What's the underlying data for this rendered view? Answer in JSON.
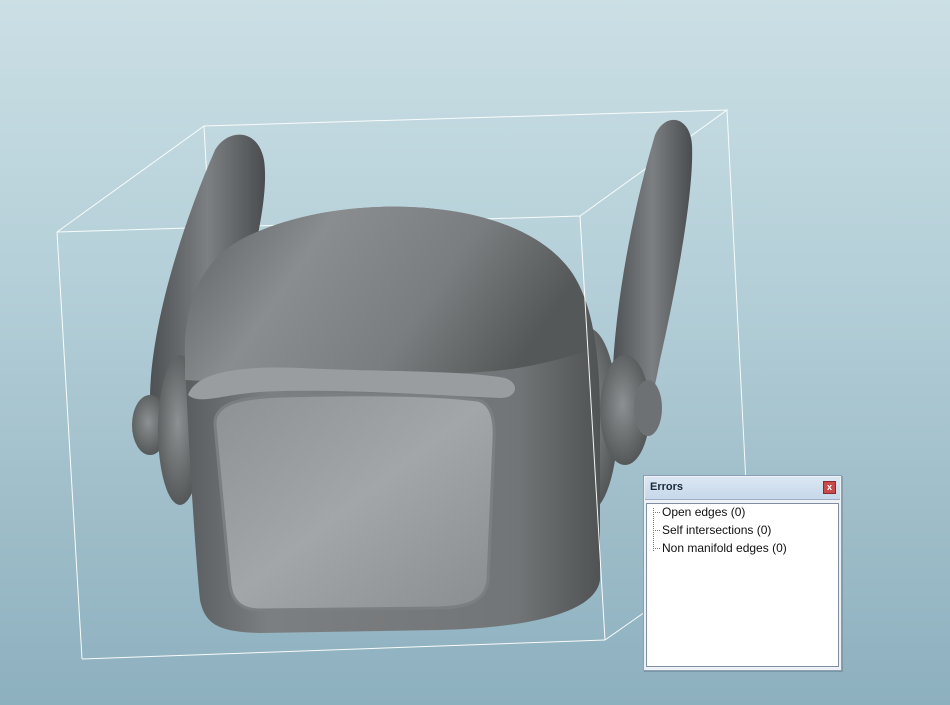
{
  "errors_panel": {
    "title": "Errors",
    "close_label": "x",
    "items": [
      {
        "label": "Open edges (0)"
      },
      {
        "label": "Self intersections (0)"
      },
      {
        "label": "Non manifold edges (0)"
      }
    ]
  },
  "colors": {
    "background_top": "#cbdfe5",
    "background_bottom": "#8db0bf",
    "model": "#6f7274",
    "bounding_box": "#ffffff",
    "close_button": "#c94a4a"
  }
}
